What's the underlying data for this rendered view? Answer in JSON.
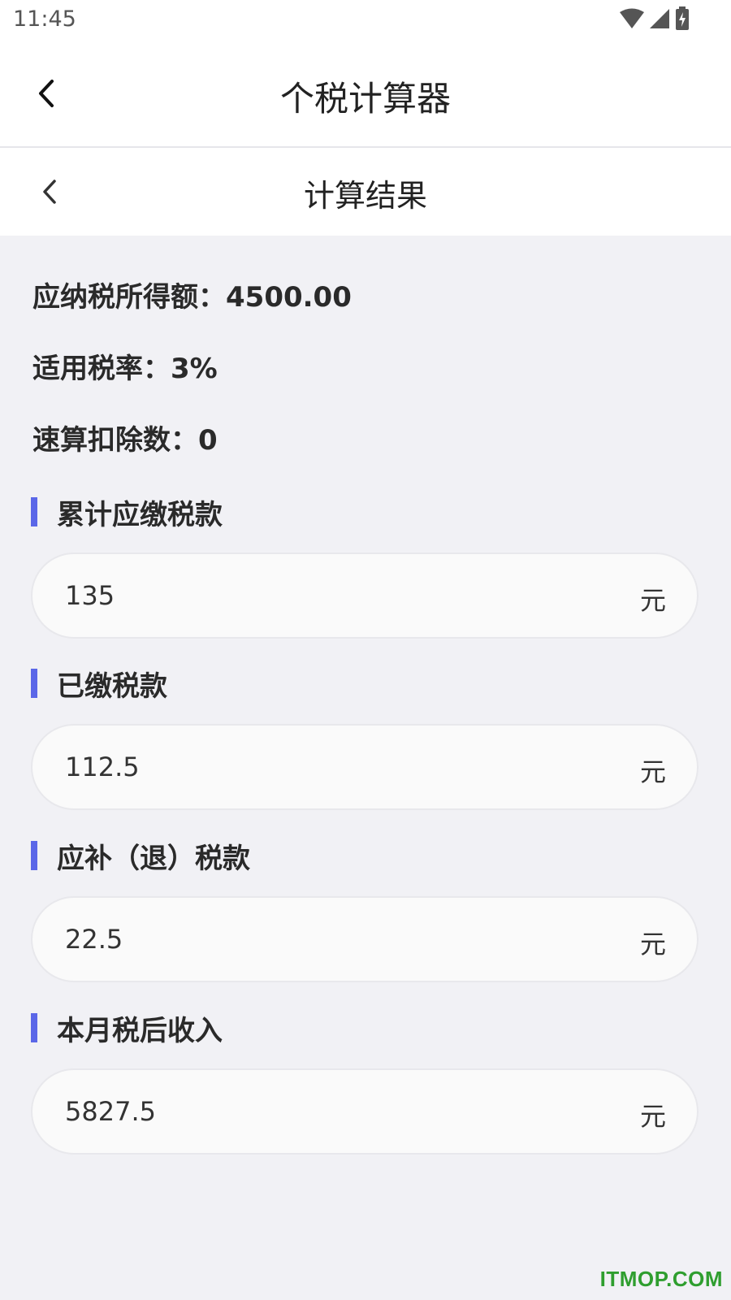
{
  "status_bar": {
    "time": "11:45"
  },
  "app_bar": {
    "title": "个税计算器"
  },
  "sub_bar": {
    "title": "计算结果"
  },
  "summary": [
    {
      "label": "应纳税所得额：",
      "value": "4500.00"
    },
    {
      "label": "适用税率：",
      "value": "3%"
    },
    {
      "label": "速算扣除数：",
      "value": "0"
    }
  ],
  "results": [
    {
      "label": "累计应缴税款",
      "value": "135",
      "unit": "元"
    },
    {
      "label": "已缴税款",
      "value": "112.5",
      "unit": "元"
    },
    {
      "label": "应补（退）税款",
      "value": "22.5",
      "unit": "元"
    },
    {
      "label": "本月税后收入",
      "value": "5827.5",
      "unit": "元"
    }
  ],
  "watermark": "ITMOP.COM",
  "colors": {
    "accent": "#5b67e8",
    "background": "#f1f1f5",
    "watermark": "#2f9e2f"
  }
}
